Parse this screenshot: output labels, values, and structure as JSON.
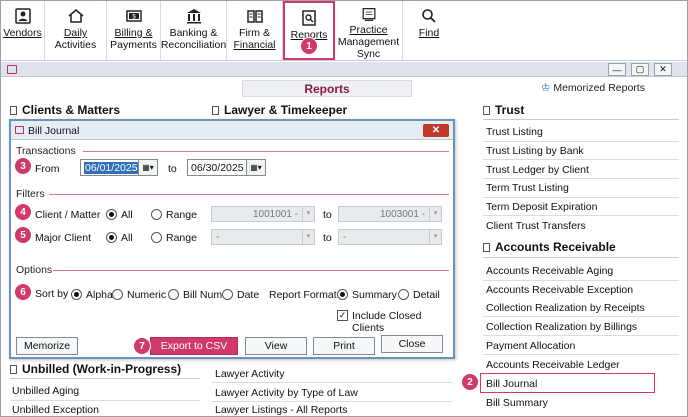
{
  "toolbar": {
    "vendors": "Vendors",
    "daily": [
      "Daily",
      "Activities"
    ],
    "billing": [
      "Billing &",
      "Payments"
    ],
    "banking": [
      "Banking &",
      "Reconciliation"
    ],
    "firm": [
      "Firm &",
      "Financial"
    ],
    "reports": "Reports",
    "pms": [
      "Practice",
      "Management",
      "Sync"
    ],
    "find": "Find"
  },
  "badges": [
    "1",
    "2",
    "3",
    "4",
    "5",
    "6",
    "7"
  ],
  "window": {
    "title": "Reports",
    "memorized": "Memorized Reports"
  },
  "columns": {
    "clients": "Clients & Matters",
    "lawyer": "Lawyer & Timekeeper",
    "trust": "Trust",
    "ar": "Accounts Receivable",
    "unbilled": "Unbilled (Work-in-Progress)"
  },
  "trust_items": [
    "Trust Listing",
    "Trust Listing by Bank",
    "Trust Ledger by Client",
    "Term Trust Listing",
    "Term Deposit Expiration",
    "Client Trust Transfers"
  ],
  "ar_items": [
    "Accounts Receivable Aging",
    "Accounts Receivable Exception",
    "Collection Realization by Receipts",
    "Collection Realization by Billings",
    "Payment Allocation",
    "Accounts Receivable Ledger",
    "Bill Journal",
    "Bill Summary"
  ],
  "unbilled_items": [
    "Unbilled Aging",
    "Unbilled Exception"
  ],
  "lawyer_items": [
    "Lawyer Activity",
    "Lawyer Activity by Type of Law",
    "Lawyer Listings - All Reports"
  ],
  "dialog": {
    "title": "Bill Journal",
    "transactions": "Transactions",
    "from_label": "From",
    "from_value": "06/01/2025",
    "to_label": "to",
    "to_value": "06/30/2025",
    "filters": "Filters",
    "client_matter": "Client / Matter",
    "major_client": "Major Client",
    "all": "All",
    "range": "Range",
    "cm_from": "1001001 -",
    "cm_to": "1003001 -",
    "mc_from": "-",
    "mc_to": "-",
    "range_to": "to",
    "options": "Options",
    "sort_by": "Sort by",
    "alpha": "Alpha",
    "numeric": "Numeric",
    "bill_num": "Bill Num",
    "date": "Date",
    "report_format": "Report Format",
    "summary": "Summary",
    "detail": "Detail",
    "include_closed": "Include Closed Clients",
    "memorize": "Memorize",
    "export_csv": "Export to CSV",
    "view": "View",
    "print": "Print",
    "close": "Close"
  }
}
